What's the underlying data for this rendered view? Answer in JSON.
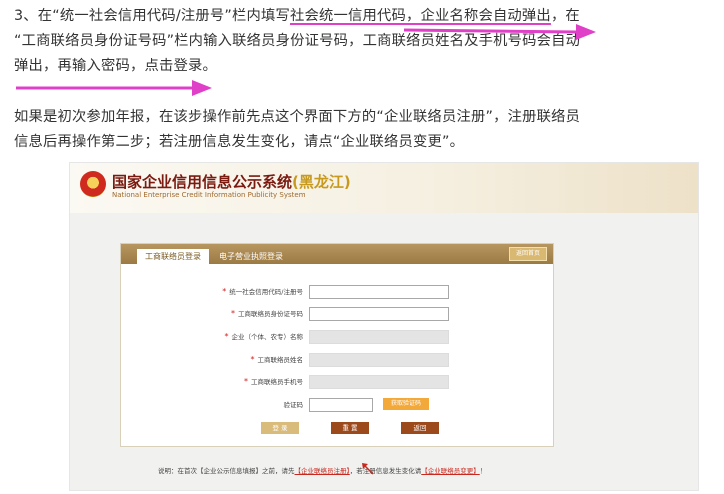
{
  "article": {
    "para1_lines": [
      "3、在“统一社会信用代码/注册号”栏内填写社会统一信用代码，企业名称会自动弹出，在",
      "“工商联络员身份证号码”栏内输入联络员身份证号码，工商联络员姓名及手机号码会自动",
      "弹出，再输入密码，点击登录。"
    ],
    "para2_lines": [
      "如果是初次参加年报，在该步操作前先点这个界面下方的“企业联络员注册”，注册联络员",
      "信息后再操作第二步；若注册信息发生变化，请点“企业联络员变更”。"
    ]
  },
  "screenshot": {
    "banner": {
      "title": "国家企业信用信息公示系统",
      "region": "(黑龙江)",
      "subtitle": "National Enterprise Credit Information Publicity System"
    },
    "tabs": {
      "active": "工商联络员登录",
      "other": "电子营业执照登录"
    },
    "home_button": "返回首页",
    "fields": [
      {
        "label": "统一社会信用代码/注册号",
        "required": "*",
        "value": "",
        "disabled": false
      },
      {
        "label": "工商联络员身份证号码",
        "required": "*",
        "value": "",
        "disabled": false
      },
      {
        "label": "企业（个体、农专）名称",
        "required": "*",
        "value": "",
        "disabled": true
      },
      {
        "label": "工商联络员姓名",
        "required": "*",
        "value": "",
        "disabled": true
      },
      {
        "label": "工商联络员手机号",
        "required": "*",
        "value": "",
        "disabled": true
      }
    ],
    "captcha": {
      "label": "验证码",
      "value": "",
      "button": "获取验证码"
    },
    "buttons": {
      "login": "登 录",
      "reset": "重 置",
      "back": "返回"
    },
    "note": {
      "prefix": "说明：在首次【企业公示信息填报】之前，请先",
      "register_link": "【企业联络员注册】",
      "middle": "，若注册信息发生变化请",
      "change_link": "【企业联络员变更】",
      "suffix": "！"
    }
  },
  "colors": {
    "annotation_arrow": "#e040c8",
    "panel_header": "#a8874e",
    "accent_button": "#f3a83a"
  }
}
